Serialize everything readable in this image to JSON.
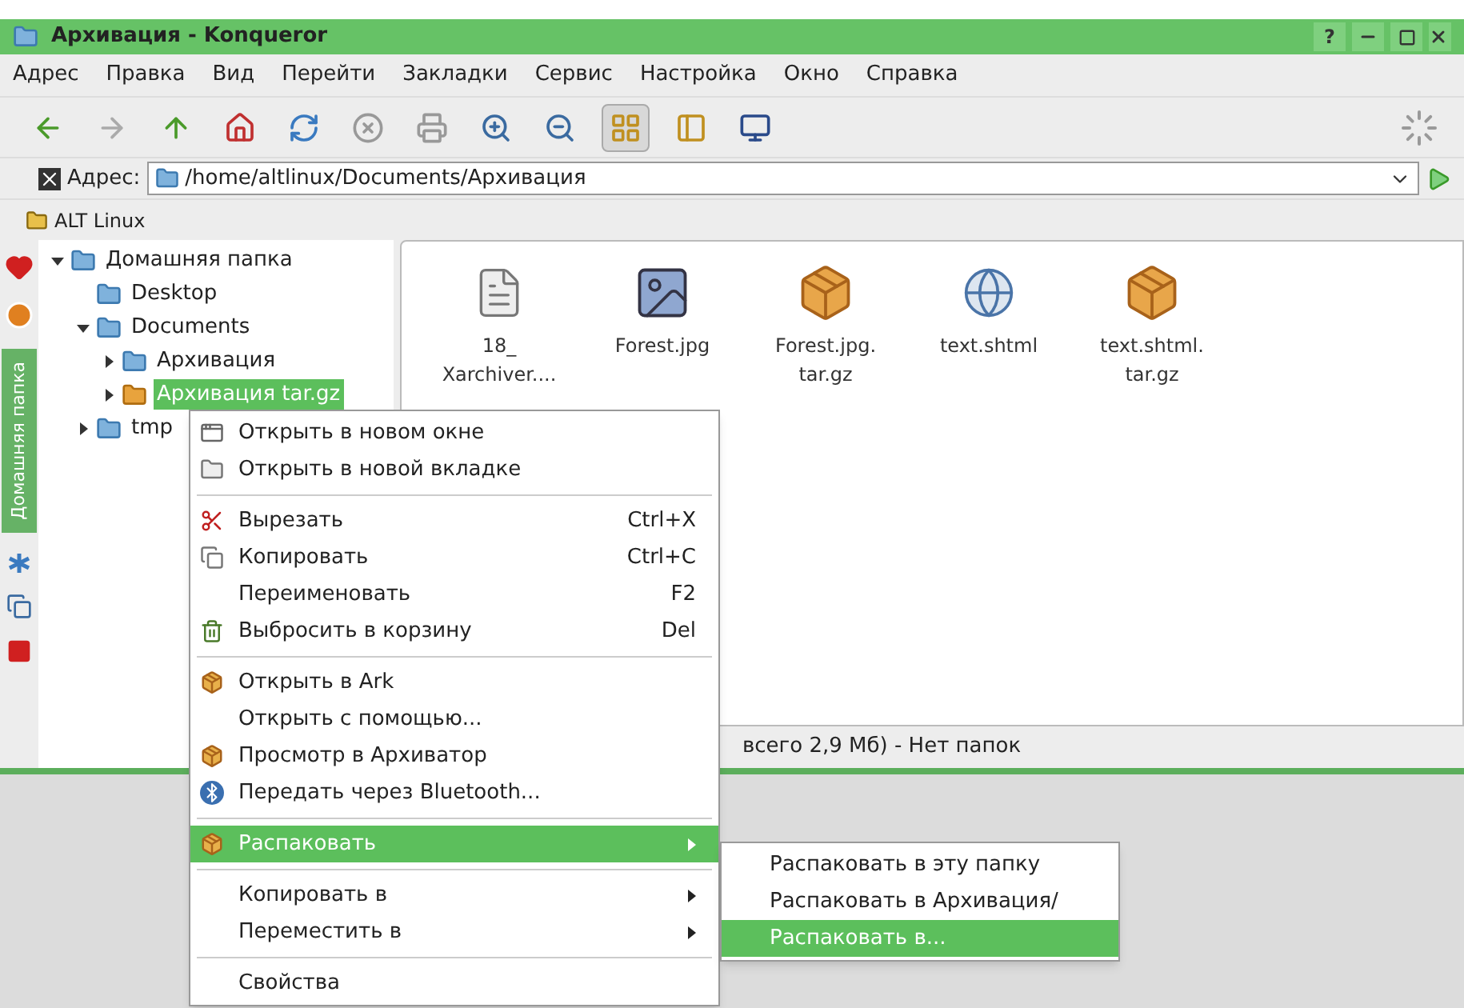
{
  "window": {
    "title": "Архивация - Konqueror",
    "help": "?"
  },
  "menubar": [
    "Адрес",
    "Правка",
    "Вид",
    "Перейти",
    "Закладки",
    "Сервис",
    "Настройка",
    "Окно",
    "Справка"
  ],
  "address": {
    "label": "Адрес:",
    "value": "/home/altlinux/Documents/Архивация"
  },
  "bookmarks": [
    "ALT Linux"
  ],
  "side_tab": "Домашняя папка",
  "tree": [
    {
      "label": "Домашняя папка",
      "expanded": true,
      "selected": false,
      "children": [
        {
          "label": "Desktop",
          "selected": false
        },
        {
          "label": "Documents",
          "expanded": true,
          "selected": false,
          "children": [
            {
              "label": "Архивация",
              "expanded": false,
              "selected": false
            },
            {
              "label": "Архивация tar.gz",
              "expanded": false,
              "selected": true
            }
          ]
        },
        {
          "label": "tmp",
          "expanded": false,
          "selected": false
        }
      ]
    }
  ],
  "files": [
    {
      "kind": "document",
      "name": "18_ Xarchiver...."
    },
    {
      "kind": "image",
      "name": "Forest.jpg"
    },
    {
      "kind": "archive",
      "name": "Forest.jpg. tar.gz"
    },
    {
      "kind": "webpage",
      "name": "text.shtml"
    },
    {
      "kind": "archive",
      "name": "text.shtml. tar.gz"
    }
  ],
  "status_bar": "всего 2,9 Мб) - Нет папок",
  "context_menu": [
    {
      "kind": "item",
      "label": "Открыть в новом окне",
      "selected": false
    },
    {
      "kind": "item",
      "label": "Открыть в новой вкладке",
      "selected": false
    },
    {
      "kind": "separator"
    },
    {
      "kind": "item",
      "label": "Вырезать",
      "shortcut": "Ctrl+X",
      "selected": false
    },
    {
      "kind": "item",
      "label": "Копировать",
      "shortcut": "Ctrl+C",
      "selected": false
    },
    {
      "kind": "item",
      "label": "Переименовать",
      "shortcut": "F2",
      "selected": false
    },
    {
      "kind": "item",
      "label": "Выбросить в корзину",
      "shortcut": "Del",
      "selected": false
    },
    {
      "kind": "separator"
    },
    {
      "kind": "item",
      "label": "Открыть в Ark",
      "selected": false
    },
    {
      "kind": "item",
      "label": "Открыть с помощью...",
      "selected": false
    },
    {
      "kind": "item",
      "label": "Просмотр в Архиватор",
      "selected": false
    },
    {
      "kind": "item",
      "label": "Передать через Bluetooth...",
      "selected": false
    },
    {
      "kind": "separator"
    },
    {
      "kind": "submenu",
      "label": "Распаковать",
      "selected": true
    },
    {
      "kind": "separator"
    },
    {
      "kind": "submenu",
      "label": "Копировать в",
      "selected": false
    },
    {
      "kind": "submenu",
      "label": "Переместить в",
      "selected": false
    },
    {
      "kind": "separator"
    },
    {
      "kind": "item",
      "label": "Свойства",
      "selected": false
    }
  ],
  "submenu": [
    {
      "label": "Распаковать в эту папку",
      "selected": false
    },
    {
      "label": "Распаковать в Архивация/",
      "selected": false
    },
    {
      "label": "Распаковать в...",
      "selected": true
    }
  ]
}
